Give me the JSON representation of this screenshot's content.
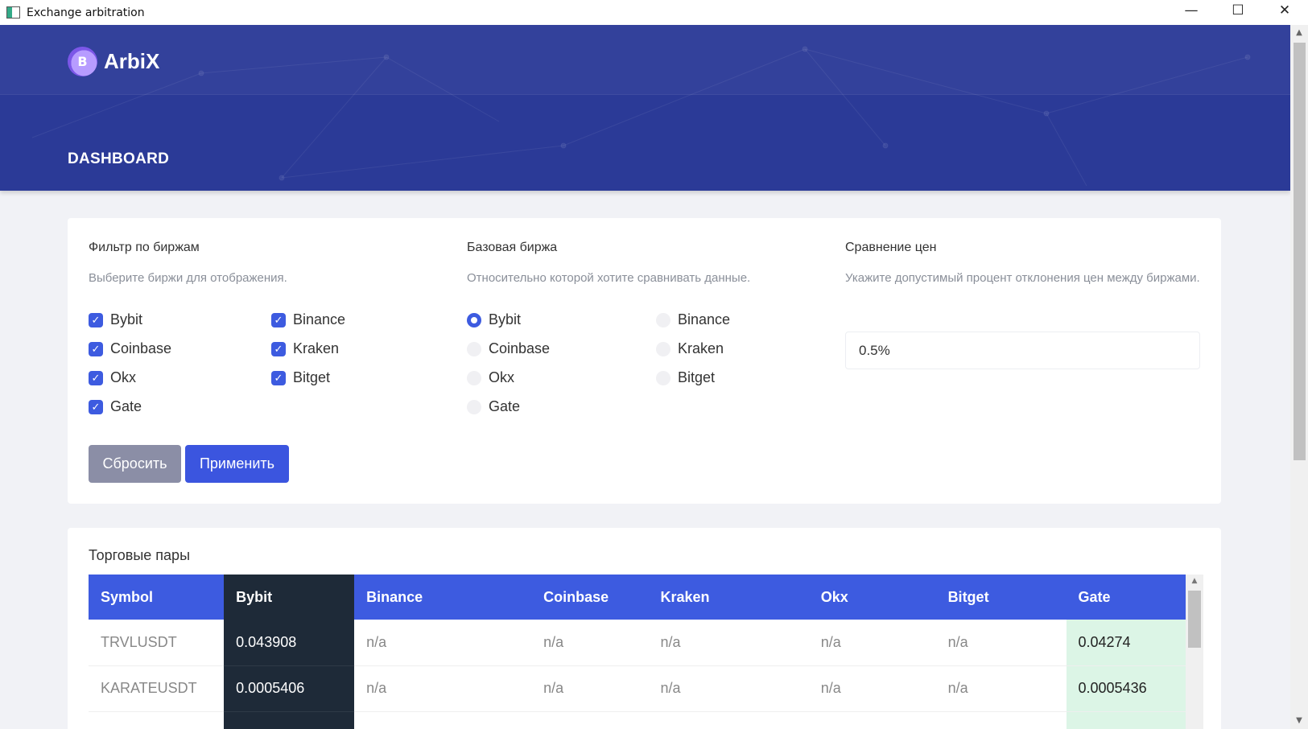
{
  "window": {
    "title": "Exchange arbitration",
    "minimize": "—",
    "maximize": "☐",
    "close": "✕"
  },
  "header": {
    "logo_text": "ArbiX",
    "logo_glyph": "B",
    "page_title": "DASHBOARD"
  },
  "filter": {
    "title": "Фильтр по биржам",
    "desc": "Выберите биржи для отображения.",
    "options": [
      {
        "label": "Bybit",
        "checked": true
      },
      {
        "label": "Binance",
        "checked": true
      },
      {
        "label": "Coinbase",
        "checked": true
      },
      {
        "label": "Kraken",
        "checked": true
      },
      {
        "label": "Okx",
        "checked": true
      },
      {
        "label": "Bitget",
        "checked": true
      },
      {
        "label": "Gate",
        "checked": true
      }
    ]
  },
  "base": {
    "title": "Базовая биржа",
    "desc": "Относительно которой хотите сравнивать данные.",
    "selected": "Bybit",
    "options": [
      {
        "label": "Bybit"
      },
      {
        "label": "Binance"
      },
      {
        "label": "Coinbase"
      },
      {
        "label": "Kraken"
      },
      {
        "label": "Okx"
      },
      {
        "label": "Bitget"
      },
      {
        "label": "Gate"
      }
    ]
  },
  "compare": {
    "title": "Сравнение цен",
    "desc": "Укажите допустимый процент отклонения цен между биржами.",
    "value": "0.5%"
  },
  "buttons": {
    "reset": "Сбросить",
    "apply": "Применить"
  },
  "pairs": {
    "title": "Торговые пары",
    "columns": [
      "Symbol",
      "Bybit",
      "Binance",
      "Coinbase",
      "Kraken",
      "Okx",
      "Bitget",
      "Gate"
    ],
    "rows": [
      [
        "TRVLUSDT",
        "0.043908",
        "n/a",
        "n/a",
        "n/a",
        "n/a",
        "n/a",
        "0.04274"
      ],
      [
        "KARATEUSDT",
        "0.0005406",
        "n/a",
        "n/a",
        "n/a",
        "n/a",
        "n/a",
        "0.0005436"
      ],
      [
        "",
        "",
        "",
        "",
        "",
        "",
        "",
        ""
      ]
    ]
  },
  "colors": {
    "header_bg": "#2b3a97",
    "accent": "#3d5be0",
    "base_col": "#1e2a38",
    "highlight": "#dcf5e6"
  }
}
